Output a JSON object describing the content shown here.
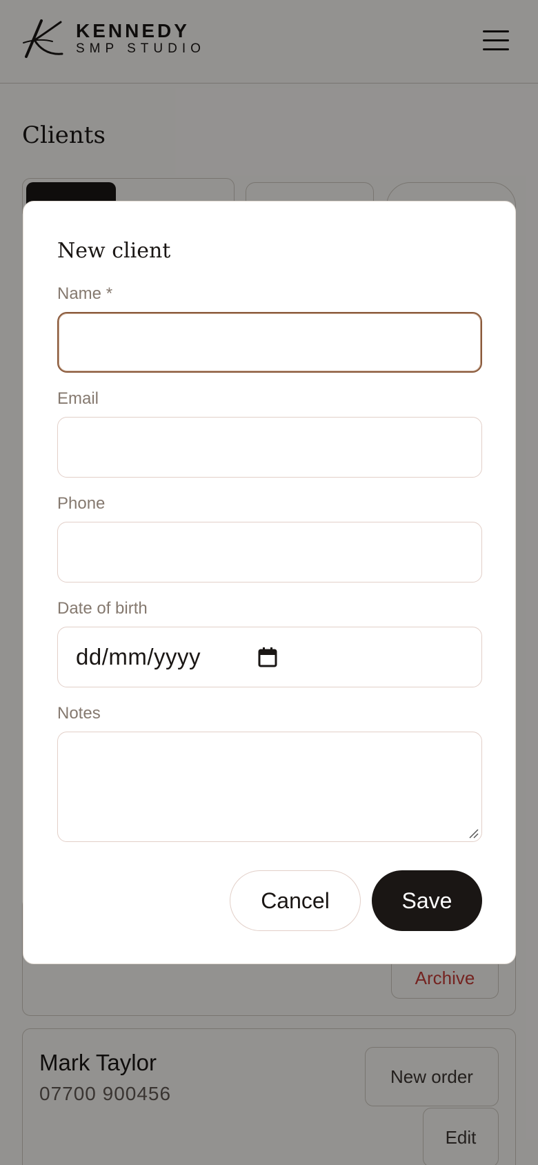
{
  "brand": {
    "name": "KENNEDY",
    "subtitle": "SMP STUDIO"
  },
  "page": {
    "title": "Clients"
  },
  "clients": [
    {
      "archive_label": "Archive"
    },
    {
      "name": "Mark Taylor",
      "phone": "07700 900456",
      "new_order_label": "New order",
      "edit_label": "Edit"
    }
  ],
  "modal": {
    "title": "New client",
    "fields": {
      "name_label": "Name *",
      "email_label": "Email",
      "phone_label": "Phone",
      "dob_label": "Date of birth",
      "dob_placeholder": "dd/mm/yyyy",
      "notes_label": "Notes"
    },
    "cancel_label": "Cancel",
    "save_label": "Save"
  },
  "colors": {
    "accent": "#1a1614",
    "focus_border": "#8a5a3c",
    "danger": "#c23b36"
  },
  "icons": {
    "menu": "hamburger-icon",
    "calendar": "calendar-icon",
    "resize": "resize-handle-icon"
  }
}
